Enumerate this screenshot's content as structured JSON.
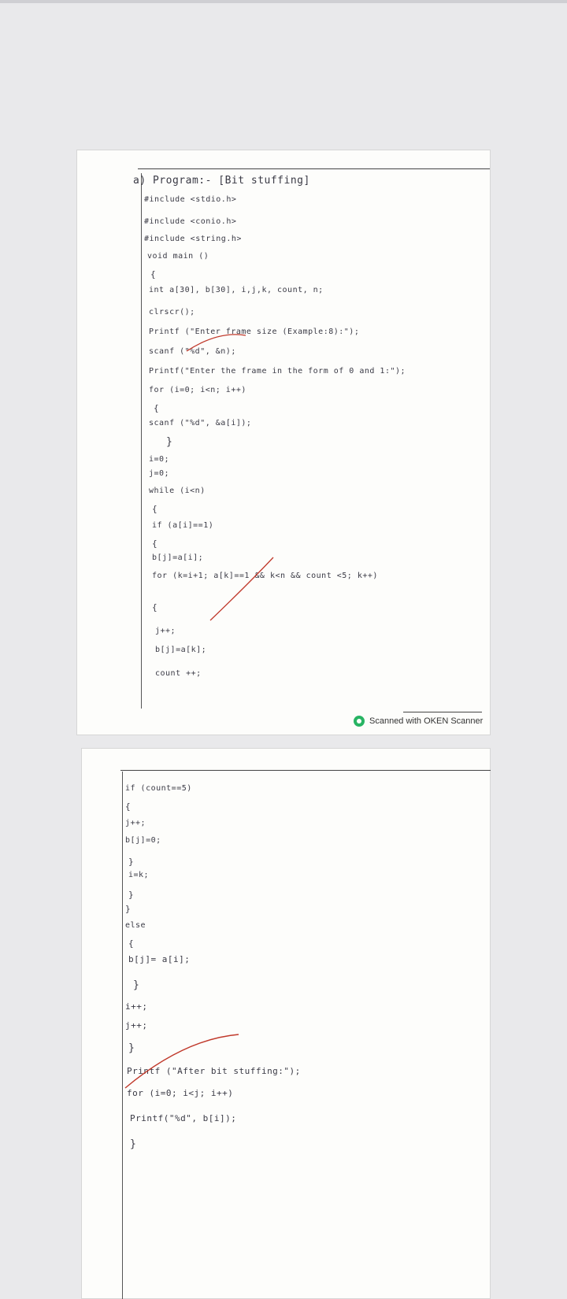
{
  "page1": {
    "header": "a) Program:- [Bit stuffing]",
    "lines": [
      "#include <stdio.h>",
      "#include <conio.h>",
      "#include <string.h>",
      "void main ()",
      "{",
      "int a[30], b[30], i,j,k, count, n;",
      "clrscr();",
      "Printf (\"Enter frame size (Example:8):\");",
      "scanf (\"%d\", &n);",
      "Printf(\"Enter the frame in the form of 0 and 1:\");",
      "for (i=0; i<n; i++)",
      "{",
      "scanf (\"%d\", &a[i]);",
      "}",
      "i=0;",
      "j=0;",
      "while (i<n)",
      "{",
      "if (a[i]==1)",
      "{",
      "b[j]=a[i];",
      "for (k=i+1; a[k]==1 && k<n && count <5; k++)",
      "{",
      "j++;",
      "b[j]=a[k];",
      "count ++;"
    ]
  },
  "page2": {
    "lines": [
      "if (count==5)",
      "{",
      "j++;",
      "b[j]=0;",
      "}",
      "i=k;",
      "}",
      "}",
      "else",
      "{",
      "b[j]= a[i];",
      "}",
      "i++;",
      "j++;",
      "}",
      "Printf (\"After bit stuffing:\");",
      "for (i=0; i<j; i++)",
      "Printf(\"%d\", b[i]);",
      "}"
    ]
  },
  "scanner_badge": "Scanned with OKEN Scanner"
}
